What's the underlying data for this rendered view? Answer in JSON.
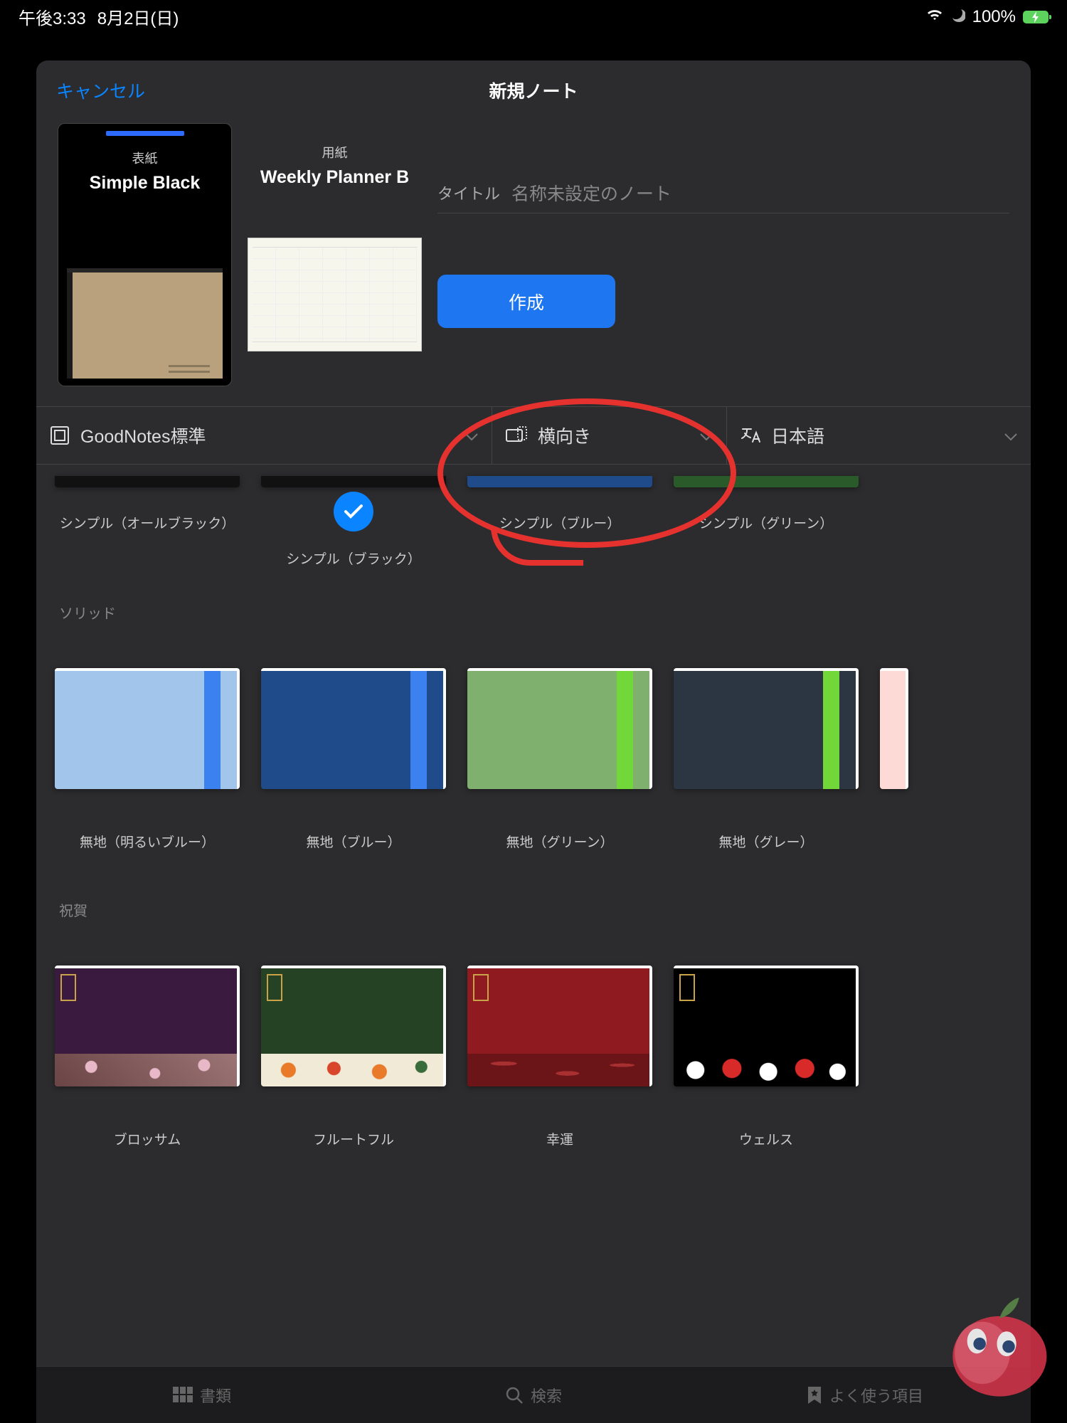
{
  "status": {
    "time": "午後3:33",
    "date": "8月2日(日)",
    "battery": "100%"
  },
  "nav": {
    "cancel": "キャンセル",
    "title": "新規ノート"
  },
  "cover": {
    "label": "表紙",
    "name": "Simple Black"
  },
  "paper": {
    "label": "用紙",
    "name": "Weekly Planner B"
  },
  "title_field": {
    "label": "タイトル",
    "placeholder": "名称未設定のノート"
  },
  "create": "作成",
  "selectors": {
    "source": "GoodNotes標準",
    "orientation": "横向き",
    "language": "日本語"
  },
  "row1": [
    {
      "cap": "シンプル（オールブラック）"
    },
    {
      "cap": "シンプル（ブラック）",
      "selected": true
    },
    {
      "cap": "シンプル（ブルー）"
    },
    {
      "cap": "シンプル（グリーン）"
    }
  ],
  "solid": {
    "heading": "ソリッド",
    "items": [
      {
        "cap": "無地（明るいブルー）",
        "cls": "th-lb"
      },
      {
        "cap": "無地（ブルー）",
        "cls": "th-bl"
      },
      {
        "cap": "無地（グリーン）",
        "cls": "th-gr"
      },
      {
        "cap": "無地（グレー）",
        "cls": "th-gy"
      }
    ]
  },
  "cel": {
    "heading": "祝賀",
    "items": [
      {
        "cap": "ブロッサム",
        "cls": "c1"
      },
      {
        "cap": "フルートフル",
        "cls": "c2"
      },
      {
        "cap": "幸運",
        "cls": "c3"
      },
      {
        "cap": "ウェルス",
        "cls": "c4"
      }
    ]
  },
  "tabs": {
    "docs": "書類",
    "search": "検索",
    "fav": "よく使う項目"
  }
}
